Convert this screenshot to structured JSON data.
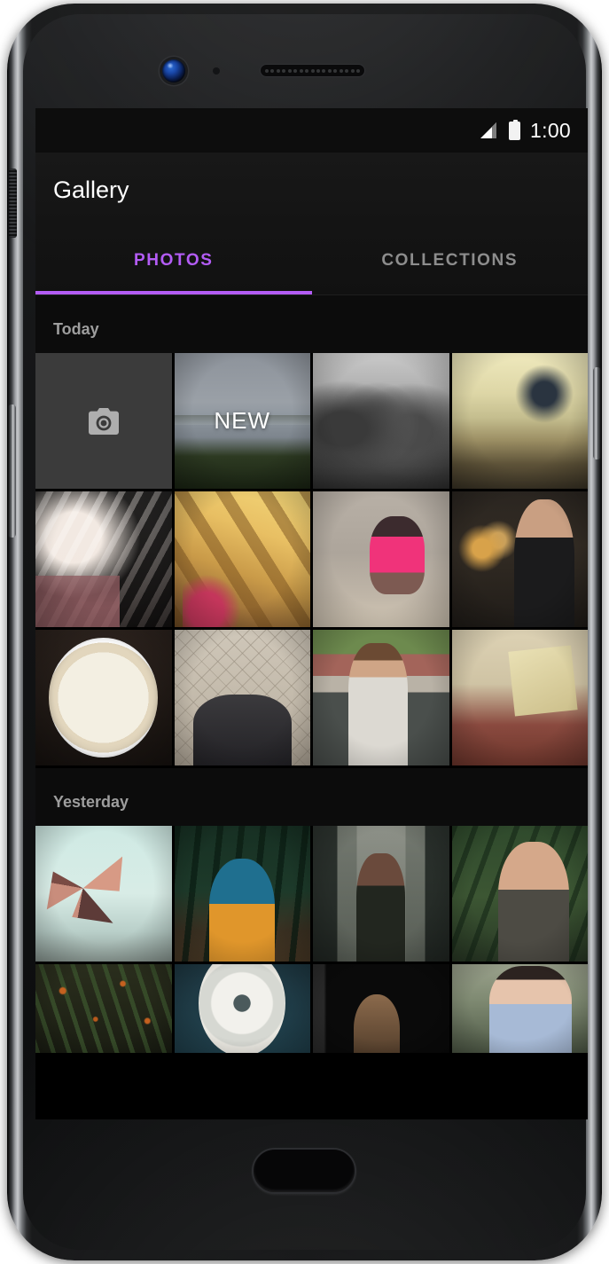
{
  "device": {
    "hardware": {
      "front_camera": "front-camera",
      "earpiece": "earpiece-speaker",
      "proximity_sensor": "proximity-sensor",
      "alert_slider": "alert-slider",
      "volume_rocker": "volume-rocker",
      "power_button": "power-button",
      "home_button": "home-button"
    }
  },
  "status_bar": {
    "signal_icon": "signal-bars-icon",
    "battery_icon": "battery-full-icon",
    "clock": "1:00"
  },
  "app_bar": {
    "title": "Gallery"
  },
  "tabs": {
    "items": [
      {
        "label": "PHOTOS",
        "active": true
      },
      {
        "label": "COLLECTIONS",
        "active": false
      }
    ],
    "active_index": 0,
    "accent_color": "#b35cf5",
    "inactive_color": "#8d8d8d"
  },
  "gallery": {
    "sections": [
      {
        "header": "Today",
        "rows": [
          [
            {
              "kind": "camera",
              "icon": "camera-icon",
              "label": ""
            },
            {
              "kind": "photo",
              "art": "art-lake",
              "label": "NEW",
              "alt": "lake-landscape"
            },
            {
              "kind": "photo",
              "art": "art-bwgroup",
              "label": "",
              "alt": "black-and-white-group"
            },
            {
              "kind": "photo",
              "art": "art-bench",
              "label": "",
              "alt": "silhouette-on-benches"
            }
          ],
          [
            {
              "kind": "photo",
              "art": "art-window",
              "label": "",
              "alt": "hand-at-window"
            },
            {
              "kind": "photo",
              "art": "art-sunset",
              "label": "",
              "alt": "golden-playground"
            },
            {
              "kind": "photo",
              "art": "art-beach",
              "label": "",
              "alt": "child-in-pink-at-beach"
            },
            {
              "kind": "photo",
              "art": "art-tablet",
              "label": "",
              "alt": "woman-holding-tablet"
            }
          ],
          [
            {
              "kind": "photo",
              "art": "art-pie",
              "label": "",
              "alt": "cream-pie-with-heart"
            },
            {
              "kind": "photo",
              "art": "art-shoes",
              "label": "",
              "alt": "looking-down-at-shoes"
            },
            {
              "kind": "photo",
              "art": "art-photographer",
              "label": "",
              "alt": "man-with-camera"
            },
            {
              "kind": "photo",
              "art": "art-reading",
              "label": "",
              "alt": "person-reading-on-couch"
            }
          ]
        ]
      },
      {
        "header": "Yesterday",
        "rows": [
          [
            {
              "kind": "photo",
              "art": "art-pinwheel",
              "label": "",
              "alt": "paper-pinwheel-and-sky"
            },
            {
              "kind": "photo",
              "art": "art-forest",
              "label": "",
              "alt": "blue-hair-in-forest"
            },
            {
              "kind": "photo",
              "art": "art-path",
              "label": "",
              "alt": "woman-with-camera-on-path"
            },
            {
              "kind": "photo",
              "art": "art-armraise",
              "label": "",
              "alt": "woman-arm-raised-in-trees"
            }
          ],
          [
            {
              "kind": "photo",
              "art": "art-berries",
              "label": "",
              "alt": "dark-foliage-with-berries"
            },
            {
              "kind": "photo",
              "art": "art-flower",
              "label": "",
              "alt": "white-chrysanthemum"
            },
            {
              "kind": "photo",
              "art": "art-dark",
              "label": "",
              "alt": "dark-interior-with-hair"
            },
            {
              "kind": "photo",
              "art": "art-girl",
              "label": "",
              "alt": "girl-in-plaid-shirt"
            }
          ]
        ]
      }
    ]
  }
}
